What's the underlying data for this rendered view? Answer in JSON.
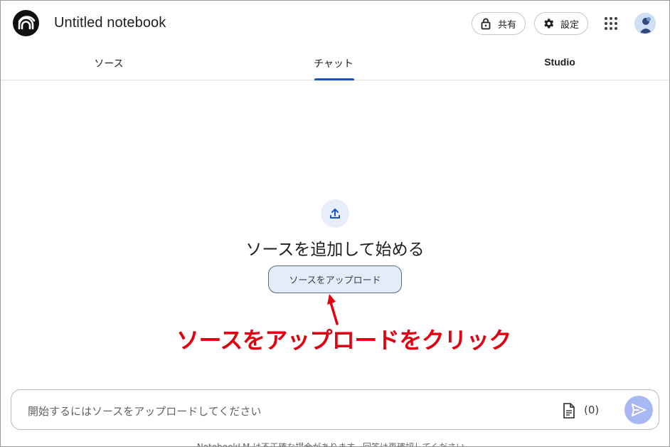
{
  "header": {
    "title": "Untitled notebook",
    "share_label": "共有",
    "settings_label": "設定"
  },
  "tabs": [
    {
      "label": "ソース"
    },
    {
      "label": "チャット"
    },
    {
      "label": "Studio"
    }
  ],
  "empty_state": {
    "heading": "ソースを追加して始める",
    "upload_label": "ソースをアップロード"
  },
  "annotation": {
    "text": "ソースをアップロードをクリック",
    "color": "#e00012"
  },
  "composer": {
    "placeholder": "開始するにはソースをアップロードしてください",
    "source_count": "(0)"
  },
  "footer": {
    "disclaimer": "NotebookLM は不正確な場合があります。回答は再確認してください。"
  },
  "colors": {
    "accent": "#1a56c4",
    "upload_button_bg": "#e3ecfb",
    "send_button_bg": "#a9b8f2"
  },
  "icons": [
    "notebooklm-logo-icon",
    "lock-icon",
    "gear-icon",
    "apps-grid-icon",
    "avatar",
    "upload-icon",
    "document-icon",
    "send-icon"
  ]
}
